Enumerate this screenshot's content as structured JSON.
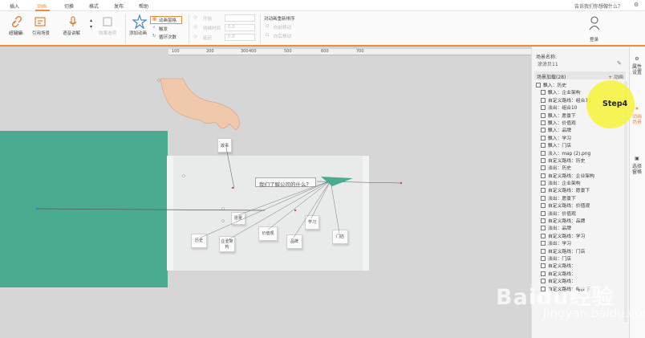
{
  "menu": {
    "items": [
      "插入",
      "动画",
      "切换",
      "格式",
      "发布",
      "帮助"
    ],
    "active": "动画",
    "search_hint": "告诉我们你想做什么？"
  },
  "ribbon": {
    "buttons": [
      {
        "label": "超链接"
      },
      {
        "label": "引用场景"
      },
      {
        "label": "语音讲解"
      },
      {
        "label": "效果选项"
      },
      {
        "label": "添加动画"
      }
    ],
    "group_label": "动画",
    "anim_options": [
      "动画窗格",
      "触发",
      "循环次数"
    ],
    "timing": [
      {
        "label": "开始",
        "value": ""
      },
      {
        "label": "持续时间",
        "value": "0.0"
      },
      {
        "label": "延迟",
        "value": "0.0"
      }
    ],
    "reorder_title": "对动画重新排序",
    "reorder_buttons": [
      "向前移动",
      "向后移动"
    ],
    "login_label": "登录"
  },
  "ruler": {
    "labels": [
      "100",
      "200",
      "300",
      "400",
      "500",
      "600",
      "700"
    ]
  },
  "slide": {
    "question": "我们了解公司的什么？",
    "cubes": [
      "故事",
      "历史",
      "企业架构",
      "价值观",
      "品牌",
      "学习",
      "门店",
      "愿景"
    ]
  },
  "panel": {
    "scene_name_label": "场景名称:",
    "scene_name": "涂涂贝11",
    "anim_header": "场景加载(28)",
    "add_anim": "+ 动画",
    "items": [
      "飘入：历史",
      "飘入：企业架构",
      "自定义路线：组合10",
      "淡出：组合10",
      "飘入：愿景下",
      "飘入：价值观",
      "飘入：品牌",
      "飘入：学习",
      "飘入：门店",
      "淡入：map (2).png",
      "自定义路线：历史",
      "淡出：历史",
      "自定义路线：企业架构",
      "淡出：企业架构",
      "自定义路线：愿景下",
      "淡出：愿景下",
      "自定义路线：价值观",
      "淡出：价值观",
      "自定义路线：品牌",
      "淡出：品牌",
      "自定义路线：学习",
      "淡出：学习",
      "自定义路线：门店",
      "淡出：门店",
      "自定义路线：",
      "自定义路线：",
      "自定义路线：",
      "自定义路线：缩放下"
    ]
  },
  "vtabs": [
    {
      "label": "属性设置"
    },
    {
      "label": "动画场景"
    },
    {
      "label": "选择窗格"
    }
  ],
  "step": {
    "label": "Step4"
  },
  "watermark": {
    "logo": "Baidu经验",
    "url": "jingyan.baidu.com"
  },
  "colors": {
    "accent": "#f08a3c",
    "green_block": "#4aab91",
    "step_bubble": "#f5f247"
  }
}
